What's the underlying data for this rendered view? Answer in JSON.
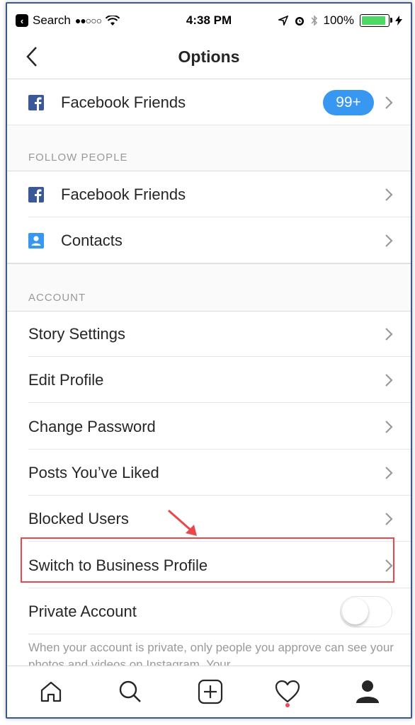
{
  "status_bar": {
    "carrier": "Search",
    "time": "4:38 PM",
    "battery": "100%"
  },
  "navbar": {
    "title": "Options"
  },
  "top_row": {
    "label": "Facebook Friends",
    "badge": "99+"
  },
  "follow_people": {
    "heading": "FOLLOW PEOPLE",
    "items": [
      {
        "label": "Facebook Friends"
      },
      {
        "label": "Contacts"
      }
    ]
  },
  "account": {
    "heading": "ACCOUNT",
    "items": [
      {
        "label": "Story Settings"
      },
      {
        "label": "Edit Profile"
      },
      {
        "label": "Change Password"
      },
      {
        "label": "Posts You’ve Liked"
      },
      {
        "label": "Blocked Users"
      },
      {
        "label": "Switch to Business Profile"
      }
    ],
    "private_account": {
      "label": "Private Account",
      "enabled": false
    },
    "footnote": "When your account is private, only people you approve can see your photos and videos on Instagram. Your"
  },
  "colors": {
    "accent": "#3897f0",
    "facebook": "#3b5998",
    "highlight": "#e8474c",
    "notification": "#ed4956"
  },
  "tabbar": {
    "tabs": [
      "home-icon",
      "search-icon",
      "add-post-icon",
      "activity-heart-icon",
      "profile-icon"
    ]
  }
}
